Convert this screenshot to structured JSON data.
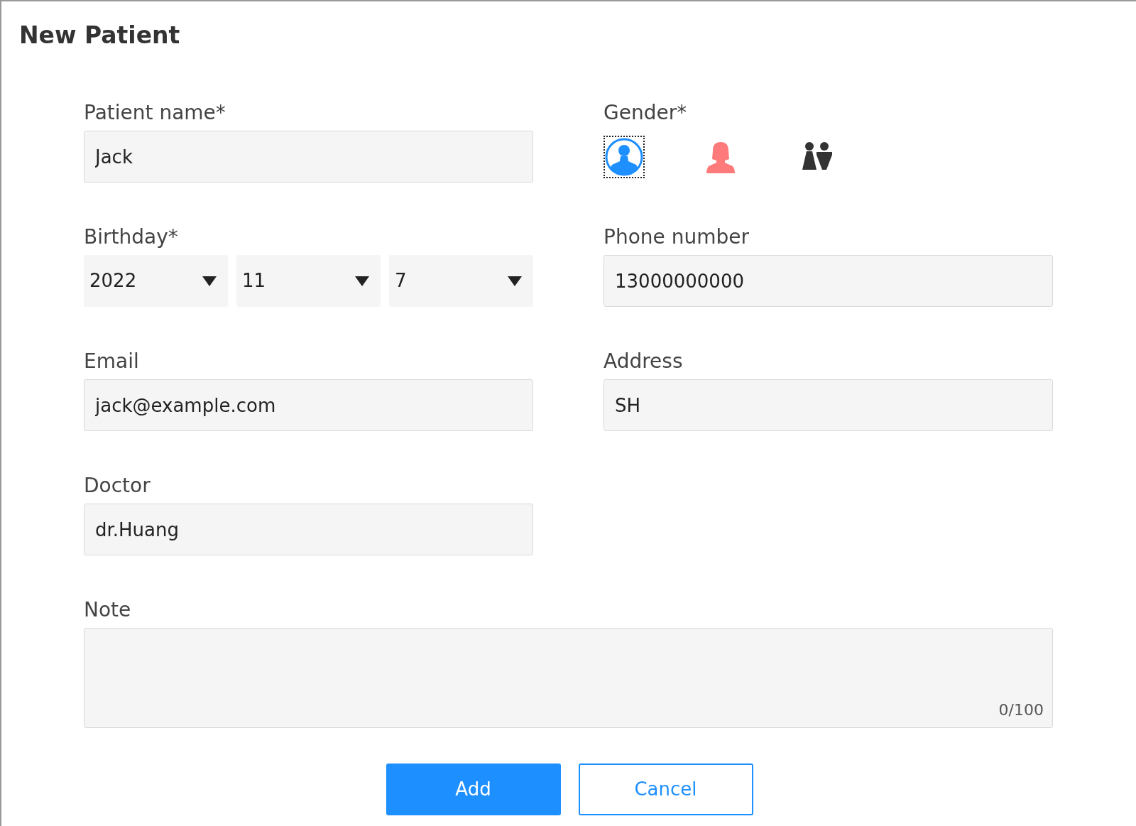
{
  "dialog": {
    "title": "New Patient"
  },
  "patient_name": {
    "label": "Patient name*",
    "value": "Jack"
  },
  "gender": {
    "label": "Gender*",
    "options": [
      {
        "kind": "male",
        "selected": true
      },
      {
        "kind": "female",
        "selected": false
      },
      {
        "kind": "other",
        "selected": false
      }
    ]
  },
  "birthday": {
    "label": "Birthday*",
    "selects": [
      {
        "value": "2022"
      },
      {
        "value": "11"
      },
      {
        "value": "7"
      }
    ]
  },
  "phone": {
    "label": "Phone number",
    "value": "13000000000"
  },
  "email": {
    "label": "Email",
    "value": "jack@example.com"
  },
  "address": {
    "label": "Address",
    "value": "SH"
  },
  "doctor": {
    "label": "Doctor",
    "value": "dr.Huang"
  },
  "note": {
    "label": "Note",
    "counter": "0/100"
  },
  "buttons": [
    {
      "kind": "primary",
      "label": "Add"
    },
    {
      "kind": "secondary",
      "label": "Cancel"
    }
  ]
}
